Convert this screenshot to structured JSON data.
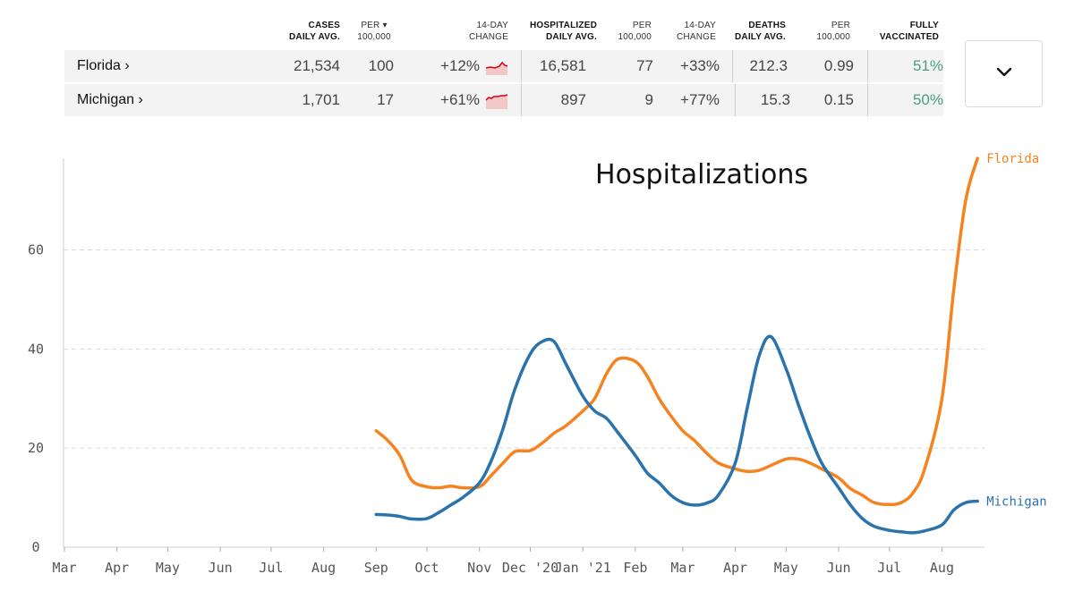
{
  "table": {
    "headers": [
      {
        "line1": "CASES",
        "line2": "DAILY AVG.",
        "bold": true
      },
      {
        "line1": "PER ▾",
        "line2": "100,000",
        "bold": false,
        "selected": true
      },
      {
        "line1": "14-DAY",
        "line2": "CHANGE",
        "bold": false
      },
      {
        "line1": "HOSPITALIZED",
        "line2": "DAILY AVG.",
        "bold": true
      },
      {
        "line1": "PER",
        "line2": "100,000",
        "bold": false
      },
      {
        "line1": "14-DAY",
        "line2": "CHANGE",
        "bold": false
      },
      {
        "line1": "DEATHS",
        "line2": "DAILY AVG.",
        "bold": true
      },
      {
        "line1": "PER",
        "line2": "100,000",
        "bold": false
      },
      {
        "line1": "FULLY",
        "line2": "VACCINATED",
        "bold": true
      }
    ],
    "rows": [
      {
        "state": "Florida ›",
        "cases": "21,534",
        "cases_per": "100",
        "cases_change": "+12%",
        "hosp": "16,581",
        "hosp_per": "77",
        "hosp_change": "+33%",
        "deaths": "212.3",
        "deaths_per": "0.99",
        "vaccinated": "51%"
      },
      {
        "state": "Michigan ›",
        "cases": "1,701",
        "cases_per": "17",
        "cases_change": "+61%",
        "hosp": "897",
        "hosp_per": "9",
        "hosp_change": "+77%",
        "deaths": "15.3",
        "deaths_per": "0.15",
        "vaccinated": "50%"
      }
    ]
  },
  "dropdown": {
    "icon": "chevron-down-icon"
  },
  "colors": {
    "florida": "#f5831f",
    "michigan": "#2b73ad",
    "vaccinated": "#4a9e83",
    "spark_line": "#d0021b",
    "spark_fill": "#f4c7c7"
  },
  "chart_data": {
    "type": "line",
    "title": "Hospitalizations",
    "xlabel": "",
    "ylabel": "",
    "x_ticks": [
      "Mar",
      "Apr",
      "May",
      "Jun",
      "Jul",
      "Aug",
      "Sep",
      "Oct",
      "Nov",
      "Dec '20",
      "Jan '21",
      "Feb",
      "Mar",
      "Apr",
      "May",
      "Jun",
      "Jul",
      "Aug"
    ],
    "y_ticks": [
      0,
      20,
      40,
      60
    ],
    "ylim": [
      0,
      78
    ],
    "xlim": [
      "2020-03-01",
      "2021-08-24"
    ],
    "grid": "horizontal dashed",
    "series": [
      {
        "name": "Florida",
        "color": "#f5831f",
        "points": [
          [
            "2020-09-01",
            23.5
          ],
          [
            "2020-09-08",
            21.5
          ],
          [
            "2020-09-15",
            18.5
          ],
          [
            "2020-09-22",
            13.5
          ],
          [
            "2020-10-01",
            12.2
          ],
          [
            "2020-10-08",
            12.0
          ],
          [
            "2020-10-15",
            12.3
          ],
          [
            "2020-10-22",
            12.0
          ],
          [
            "2020-11-01",
            12.2
          ],
          [
            "2020-11-08",
            14.5
          ],
          [
            "2020-11-15",
            17.0
          ],
          [
            "2020-11-22",
            19.3
          ],
          [
            "2020-12-01",
            19.5
          ],
          [
            "2020-12-08",
            21.0
          ],
          [
            "2020-12-15",
            23.0
          ],
          [
            "2020-12-22",
            24.5
          ],
          [
            "2021-01-01",
            27.5
          ],
          [
            "2021-01-08",
            30.0
          ],
          [
            "2021-01-15",
            35.0
          ],
          [
            "2021-01-22",
            38.0
          ],
          [
            "2021-02-01",
            37.5
          ],
          [
            "2021-02-08",
            34.5
          ],
          [
            "2021-02-15",
            30.0
          ],
          [
            "2021-02-22",
            26.5
          ],
          [
            "2021-03-01",
            23.5
          ],
          [
            "2021-03-08",
            21.5
          ],
          [
            "2021-03-15",
            19.0
          ],
          [
            "2021-03-22",
            17.0
          ],
          [
            "2021-04-01",
            15.8
          ],
          [
            "2021-04-08",
            15.3
          ],
          [
            "2021-04-15",
            15.5
          ],
          [
            "2021-04-22",
            16.5
          ],
          [
            "2021-05-01",
            17.8
          ],
          [
            "2021-05-08",
            17.8
          ],
          [
            "2021-05-15",
            17.0
          ],
          [
            "2021-05-22",
            15.8
          ],
          [
            "2021-06-01",
            14.0
          ],
          [
            "2021-06-08",
            11.8
          ],
          [
            "2021-06-15",
            10.5
          ],
          [
            "2021-06-22",
            9.0
          ],
          [
            "2021-07-01",
            8.6
          ],
          [
            "2021-07-08",
            9.0
          ],
          [
            "2021-07-15",
            11.0
          ],
          [
            "2021-07-22",
            16.0
          ],
          [
            "2021-08-01",
            30.0
          ],
          [
            "2021-08-08",
            52.0
          ],
          [
            "2021-08-15",
            70.0
          ],
          [
            "2021-08-22",
            78.5
          ]
        ]
      },
      {
        "name": "Michigan",
        "color": "#2b73ad",
        "points": [
          [
            "2020-09-01",
            6.6
          ],
          [
            "2020-09-08",
            6.5
          ],
          [
            "2020-09-15",
            6.2
          ],
          [
            "2020-09-22",
            5.7
          ],
          [
            "2020-10-01",
            5.8
          ],
          [
            "2020-10-08",
            7.0
          ],
          [
            "2020-10-15",
            8.5
          ],
          [
            "2020-10-22",
            10.0
          ],
          [
            "2020-11-01",
            13.0
          ],
          [
            "2020-11-08",
            17.5
          ],
          [
            "2020-11-15",
            24.0
          ],
          [
            "2020-11-22",
            32.0
          ],
          [
            "2020-12-01",
            39.0
          ],
          [
            "2020-12-08",
            41.5
          ],
          [
            "2020-12-15",
            41.5
          ],
          [
            "2020-12-22",
            37.0
          ],
          [
            "2021-01-01",
            30.5
          ],
          [
            "2021-01-08",
            27.5
          ],
          [
            "2021-01-15",
            26.0
          ],
          [
            "2021-01-22",
            23.0
          ],
          [
            "2021-02-01",
            18.5
          ],
          [
            "2021-02-08",
            15.0
          ],
          [
            "2021-02-15",
            13.0
          ],
          [
            "2021-02-22",
            10.5
          ],
          [
            "2021-03-01",
            9.0
          ],
          [
            "2021-03-08",
            8.5
          ],
          [
            "2021-03-15",
            8.9
          ],
          [
            "2021-03-22",
            10.5
          ],
          [
            "2021-04-01",
            17.0
          ],
          [
            "2021-04-08",
            28.0
          ],
          [
            "2021-04-15",
            38.5
          ],
          [
            "2021-04-22",
            42.5
          ],
          [
            "2021-05-01",
            36.0
          ],
          [
            "2021-05-08",
            29.0
          ],
          [
            "2021-05-15",
            22.5
          ],
          [
            "2021-05-22",
            17.0
          ],
          [
            "2021-06-01",
            12.0
          ],
          [
            "2021-06-08",
            8.5
          ],
          [
            "2021-06-15",
            5.8
          ],
          [
            "2021-06-22",
            4.2
          ],
          [
            "2021-07-01",
            3.4
          ],
          [
            "2021-07-08",
            3.1
          ],
          [
            "2021-07-15",
            2.9
          ],
          [
            "2021-07-22",
            3.3
          ],
          [
            "2021-08-01",
            4.5
          ],
          [
            "2021-08-08",
            7.5
          ],
          [
            "2021-08-15",
            9.0
          ],
          [
            "2021-08-22",
            9.3
          ]
        ]
      }
    ]
  }
}
